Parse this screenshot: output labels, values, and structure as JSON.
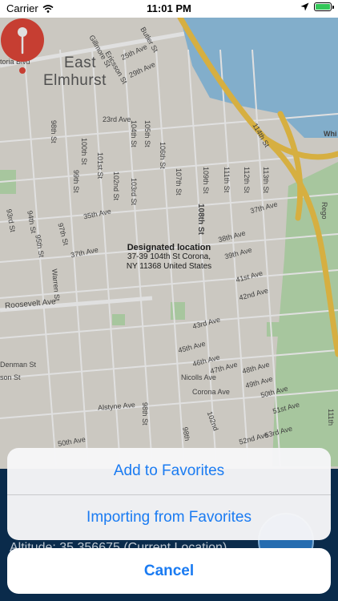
{
  "status_bar": {
    "carrier": "Carrier",
    "time": "11:01 PM"
  },
  "map": {
    "areas": [
      "East",
      "Elmhurst"
    ],
    "streets": [
      "Ericsson St",
      "Butler St",
      "Gillmore St",
      "25th Ave",
      "29th Ave",
      "toria Blvd",
      "23rd Ave",
      "98th St",
      "100th St",
      "101st St",
      "104th St",
      "105th St",
      "106th St",
      "107th St",
      "108th St",
      "109th St",
      "111th St",
      "112th St",
      "113th St",
      "114th St",
      "99th St",
      "102nd St",
      "103rd St",
      "35th Ave",
      "37th Ave",
      "38th Ave",
      "39th Ave",
      "97th St",
      "95th St",
      "94th St",
      "93rd St",
      "Warren St",
      "Roosevelt Ave",
      "41st Ave",
      "42nd Ave",
      "43rd Ave",
      "45th Ave",
      "46th Ave",
      "47th Ave",
      "48th Ave",
      "49th Ave",
      "50th Ave",
      "51st Ave",
      "Nicolls Ave",
      "Corona Ave",
      "Alstyne Ave",
      "52nd Ave",
      "53rd Ave",
      "Denman St",
      "son St",
      "50th Ave",
      "Whi",
      "Rego",
      "98th",
      "102nd",
      "111th"
    ],
    "pin": {
      "title": "Designated location",
      "address_line1": "37-39 104th St Corona,",
      "address_line2": "NY  11368 United States",
      "color": "#e2473a"
    }
  },
  "underlay": {
    "altitude_text": "Altitude: 35.356675 (Current Location)"
  },
  "action_sheet": {
    "add_to_favorites": "Add to Favorites",
    "import_from_favorites": "Importing from Favorites",
    "cancel": "Cancel"
  },
  "colors": {
    "accent": "#1a7bf2",
    "water": "#95c6e8",
    "highway": "#f4c84a",
    "park": "#bfe2b4"
  }
}
